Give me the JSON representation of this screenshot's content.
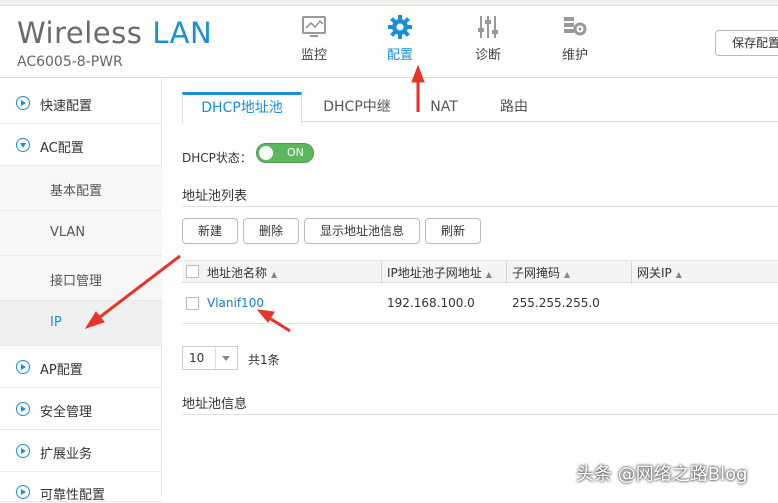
{
  "header": {
    "brand_main": "Wireless",
    "brand_accent": "LAN",
    "model": "AC6005-8-PWR",
    "save_label": "保存配置",
    "nav": [
      {
        "label": "监控",
        "icon": "monitor-icon"
      },
      {
        "label": "配置",
        "icon": "gear-icon"
      },
      {
        "label": "诊断",
        "icon": "sliders-icon"
      },
      {
        "label": "维护",
        "icon": "maintenance-icon"
      }
    ]
  },
  "sidebar": {
    "items": [
      {
        "label": "快速配置"
      },
      {
        "label": "AC配置"
      },
      {
        "label": "基本配置"
      },
      {
        "label": "VLAN"
      },
      {
        "label": "接口管理"
      },
      {
        "label": "IP"
      },
      {
        "label": "AP配置"
      },
      {
        "label": "安全管理"
      },
      {
        "label": "扩展业务"
      },
      {
        "label": "可靠性配置"
      }
    ]
  },
  "tabs": [
    "DHCP地址池",
    "DHCP中继",
    "NAT",
    "路由"
  ],
  "dhcp": {
    "status_label": "DHCP状态：",
    "toggle_text": "ON"
  },
  "pool_list": {
    "title": "地址池列表",
    "buttons": [
      "新建",
      "删除",
      "显示地址池信息",
      "刷新"
    ],
    "columns": [
      "地址池名称",
      "IP地址池子网地址",
      "子网掩码",
      "网关IP"
    ],
    "rows": [
      {
        "name": "Vlanif100",
        "subnet": "192.168.100.0",
        "mask": "255.255.255.0",
        "gateway": ""
      }
    ],
    "page_size": "10",
    "total": "共1条"
  },
  "pool_info": {
    "title": "地址池信息"
  },
  "watermark": "头条 @网络之路Blog",
  "colors": {
    "accent": "#1a8fd8",
    "toggle_on": "#5cb85c",
    "link": "#1a7bc4",
    "annotation_arrow": "#e8332a"
  }
}
